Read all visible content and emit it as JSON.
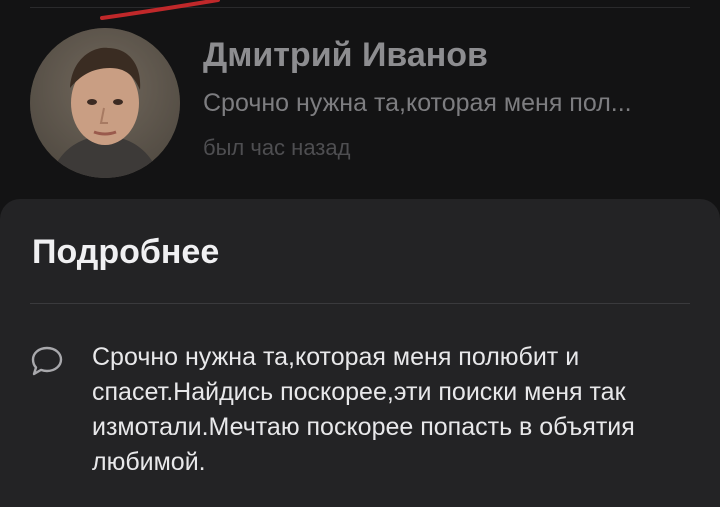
{
  "profile": {
    "name": "Дмитрий Иванов",
    "status": "Срочно нужна та,которая меня пол...",
    "last_seen": "был час назад"
  },
  "details": {
    "title": "Подробнее",
    "about_text": "Срочно нужна та,которая меня полюбит и спасет.Найдись поскорее,эти поиски меня так измотали.Мечтаю поскорее попасть в объятия любимой."
  },
  "icons": {
    "about": "speech-bubble-icon"
  },
  "colors": {
    "background": "#131314",
    "sheet": "#232325",
    "annotation_mark": "#c0282a"
  }
}
